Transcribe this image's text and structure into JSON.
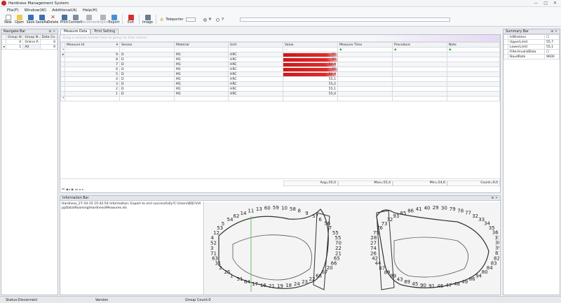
{
  "window": {
    "title": "Hardness Management System",
    "controls": [
      "—",
      "□",
      "✕"
    ]
  },
  "menu": [
    "File(F)",
    "Window(W)",
    "Additional(A)",
    "Help(H)"
  ],
  "toolbar": {
    "buttons": [
      {
        "label": "New",
        "color": "#ffffff"
      },
      {
        "label": "Open",
        "color": "#f2c94c"
      },
      {
        "label": "Save",
        "color": "#3b6fb6"
      },
      {
        "label": "SaveAs",
        "color": "#3b6fb6"
      },
      {
        "label": "Delete",
        "color": "#d32f2f"
      },
      {
        "label": "Print",
        "color": "#4a6fa5"
      },
      {
        "label": "Connect",
        "color": "#7f8c9b"
      },
      {
        "label": "Disconnect",
        "color": "#b0b5bd"
      },
      {
        "label": "Import",
        "color": "#b0b5bd"
      },
      {
        "label": "Export",
        "color": "#4a90d9"
      },
      {
        "label": "Exit",
        "color": "#d32f2f"
      },
      {
        "label": "Image",
        "color": "#6b7b8c"
      }
    ],
    "teleporter_label": "Teleporter",
    "radio_h": "H",
    "radio_y": "Y"
  },
  "navigate": {
    "title": "Navigate Bar",
    "columns": [
      "Group Id",
      "Group N...",
      "Data Co..."
    ],
    "rows": [
      {
        "id": "0",
        "name": "Online P...",
        "count": "0"
      },
      {
        "id": "1",
        "name": "All",
        "count": "9"
      }
    ]
  },
  "tabs": [
    "Measure Data",
    "Print Setting"
  ],
  "grid": {
    "group_hint": "Drag a column header here to group by that column",
    "columns": [
      "Measure Id",
      "Sensor",
      "Material",
      "Unit",
      "Value",
      "Measure Time",
      "Procedure",
      "Note"
    ],
    "rows": [
      {
        "id": "9",
        "sensor": "D",
        "material": "M1",
        "unit": "HRC",
        "value": "55",
        "bar": 1.0
      },
      {
        "id": "8",
        "sensor": "D",
        "material": "M1",
        "unit": "HRC",
        "value": "55",
        "bar": 1.0
      },
      {
        "id": "7",
        "sensor": "D",
        "material": "M1",
        "unit": "HRC",
        "value": "54,9",
        "bar": 0.97
      },
      {
        "id": "6",
        "sensor": "D",
        "material": "M1",
        "unit": "HRC",
        "value": "55",
        "bar": 1.0
      },
      {
        "id": "5",
        "sensor": "D",
        "material": "M1",
        "unit": "HRC",
        "value": "54,9",
        "bar": 0.97
      },
      {
        "id": "4",
        "sensor": "D",
        "material": "M1",
        "unit": "HRC",
        "value": "55,1",
        "bar": 0
      },
      {
        "id": "3",
        "sensor": "D",
        "material": "M1",
        "unit": "HRC",
        "value": "55,2",
        "bar": 0
      },
      {
        "id": "2",
        "sensor": "D",
        "material": "M1",
        "unit": "HRC",
        "value": "55,1",
        "bar": 0
      },
      {
        "id": "1",
        "sensor": "D",
        "material": "M1",
        "unit": "HRC",
        "value": "55,4",
        "bar": 0
      }
    ],
    "footer": {
      "avg": "Avg=55,0",
      "max": "Max=55,4",
      "min": "Min=54,6",
      "count": "Count=9,0"
    }
  },
  "summary": {
    "title": "Summary Bar",
    "rows": [
      {
        "label": "IsWireless",
        "value": "☐"
      },
      {
        "label": "UpperLimit",
        "value": "55,7"
      },
      {
        "label": "LowerLimit",
        "value": "55,1"
      },
      {
        "label": "FilterInvalidData",
        "value": "☐"
      },
      {
        "label": "BaudRate",
        "value": "9600"
      }
    ]
  },
  "info": {
    "title": "Information Bar",
    "message": "Hardness_27-10-15 15:42:54 Information: Export to xml successfully!C:\\Users\\BQCV\\AppData\\Roaming\\Hardness\\Measures.xls"
  },
  "diagram": {
    "left_labels": [
      "65",
      "66",
      "20",
      "67",
      "68",
      "22",
      "23",
      "24",
      "18",
      "19",
      "21",
      "16",
      "17",
      "64",
      "51",
      "1",
      "25",
      "2",
      "31",
      "63",
      "71",
      "3",
      "52",
      "4",
      "12",
      "53",
      "5",
      "54",
      "62",
      "14",
      "11",
      "13",
      "60",
      "59",
      "10",
      "58",
      "8",
      "9",
      "57",
      "6",
      "56",
      "7",
      "55",
      "55",
      "70",
      "22",
      "21"
    ],
    "right_labels": [
      "49",
      "48",
      "47",
      "46",
      "91",
      "90",
      "45",
      "89",
      "43",
      "89",
      "88",
      "87",
      "44",
      "42",
      "26",
      "74",
      "27",
      "28",
      "75",
      "76",
      "73",
      "72",
      "93",
      "85",
      "86",
      "41",
      "40",
      "29",
      "30",
      "79",
      "78",
      "77",
      "32",
      "33",
      "34",
      "35",
      "36",
      "37",
      "38",
      "39",
      "81",
      "82",
      "83",
      "84",
      "80",
      "94",
      "86"
    ]
  },
  "status": {
    "conn": "Status:Disconnect",
    "version": "Version",
    "group": "Group Count:0"
  }
}
